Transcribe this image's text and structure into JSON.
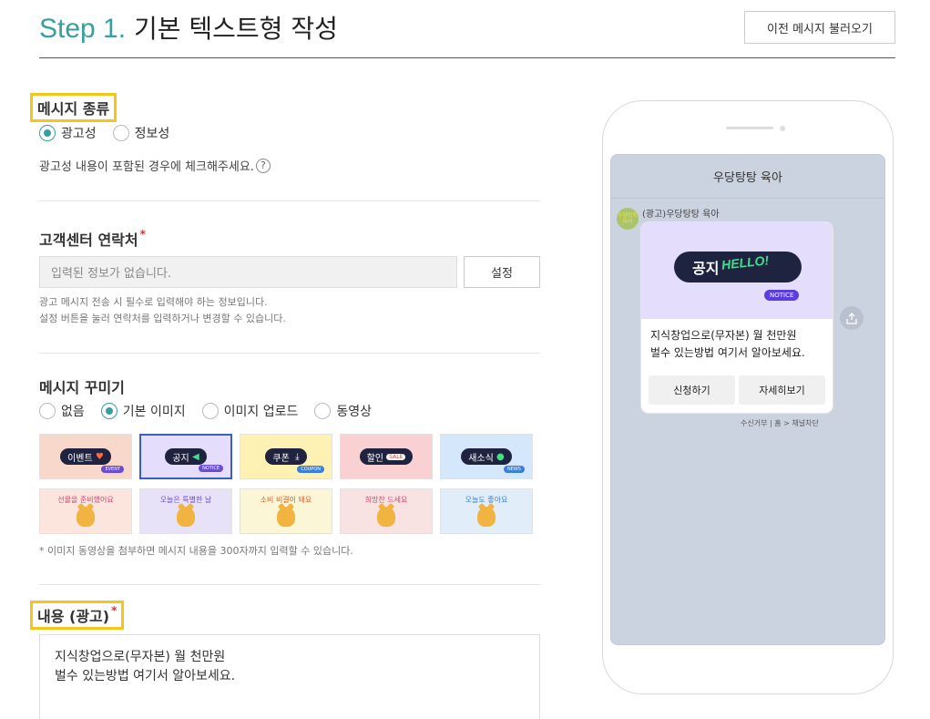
{
  "header": {
    "step_label": "Step 1.",
    "title": "기본 텍스트형 작성",
    "load_button": "이전 메시지 불러오기"
  },
  "message_type": {
    "title": "메시지 종류",
    "options": [
      {
        "label": "광고성",
        "selected": true
      },
      {
        "label": "정보성",
        "selected": false
      }
    ],
    "help_text": "광고성 내용이 포함된 경우에 체크해주세요.",
    "help_icon": "?"
  },
  "contact": {
    "title": "고객센터 연락처",
    "required_mark": "*",
    "input_placeholder": "입력된 정보가 없습니다.",
    "set_button": "설정",
    "note_line1": "광고 메시지 전송 시 필수로 입력해야 하는 정보입니다.",
    "note_line2": "설정 버튼을 눌러 연락처를 입력하거나 변경할 수 있습니다."
  },
  "decoration": {
    "title": "메시지 꾸미기",
    "options": [
      {
        "label": "없음",
        "selected": false
      },
      {
        "label": "기본 이미지",
        "selected": true
      },
      {
        "label": "이미지 업로드",
        "selected": false
      },
      {
        "label": "동영상",
        "selected": false
      }
    ],
    "thumbnails_row1": [
      {
        "label": "이벤트",
        "bg": "#f9d8cc",
        "tag": "EVENT"
      },
      {
        "label": "공지",
        "bg": "#e4ddfb",
        "tag": "NOTICE",
        "selected": true
      },
      {
        "label": "쿠폰",
        "bg": "#fdf2b4",
        "tag": "COUPON"
      },
      {
        "label": "할인",
        "bg": "#fad1d3",
        "tag": "SALE"
      },
      {
        "label": "새소식",
        "bg": "#d4e7fb",
        "tag": "NEWS"
      }
    ],
    "thumbnails_row2": [
      {
        "label": "선물을 준비했어요",
        "bg": "#fbe5dc"
      },
      {
        "label": "오늘은 특별한 날",
        "bg": "#e7e2f8"
      },
      {
        "label": "소비 비결이 돼요",
        "bg": "#fbf6d6"
      },
      {
        "label": "희망찬 드세요",
        "bg": "#f9e3e2"
      },
      {
        "label": "오늘도 좋아요",
        "bg": "#e1eefa"
      }
    ],
    "note": "* 이미지 동영상을 첨부하면 메시지 내용을 300자까지 입력할 수 있습니다."
  },
  "content": {
    "title": "내용 (광고)",
    "required_mark": "*",
    "line1": "지식창업으로(무자본) 월 천만원",
    "line2": "벌수 있는방법 여기서 알아보세요."
  },
  "preview": {
    "chat_title": "우당탕탕 육아",
    "avatar_text": "우당탕탕 육아",
    "sender": "(광고)우당탕탕 육아",
    "notice_label": "공지",
    "hello_text": "HELLO!",
    "notice_tag": "NOTICE",
    "message_line1": "지식창업으로(무자본) 월 천만원",
    "message_line2": "벌수 있는방법 여기서 알아보세요.",
    "button1": "신청하기",
    "button2": "자세히보기",
    "reject_text": "수신거부 | 홈 > 채널차단",
    "share_icon": "share-icon"
  }
}
